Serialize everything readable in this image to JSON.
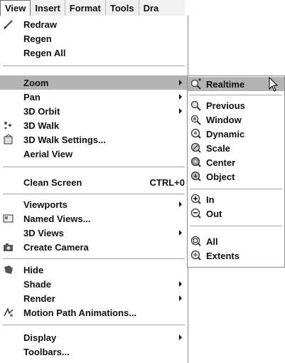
{
  "menubar": [
    {
      "label": "View",
      "active": true
    },
    {
      "label": "Insert"
    },
    {
      "label": "Format"
    },
    {
      "label": "Tools"
    },
    {
      "label": "Dra",
      "clipped": true
    }
  ],
  "view_menu": {
    "items": [
      {
        "label": "Redraw",
        "icon": "pencil-icon"
      },
      {
        "label": "Regen"
      },
      {
        "label": "Regen All"
      },
      {
        "label": "Zoom",
        "submenu": true,
        "highlighted": true
      },
      {
        "label": "Pan",
        "submenu": true
      },
      {
        "label": "3D Orbit",
        "submenu": true
      },
      {
        "label": "3D Walk",
        "icon": "walk-icon"
      },
      {
        "label": "3D Walk Settings...",
        "icon": "walk-settings-icon"
      },
      {
        "label": "Aerial View"
      },
      {
        "label": "Clean Screen",
        "shortcut": "CTRL+0"
      },
      {
        "label": "Viewports",
        "submenu": true
      },
      {
        "label": "Named Views...",
        "icon": "named-views-icon"
      },
      {
        "label": "3D Views",
        "submenu": true
      },
      {
        "label": "Create Camera",
        "icon": "camera-icon"
      },
      {
        "label": "Hide",
        "icon": "hide-icon"
      },
      {
        "label": "Shade",
        "submenu": true
      },
      {
        "label": "Render",
        "submenu": true
      },
      {
        "label": "Motion Path Animations...",
        "icon": "motion-path-icon"
      },
      {
        "label": "Display",
        "submenu": true
      },
      {
        "label": "Toolbars..."
      }
    ]
  },
  "zoom_submenu": {
    "items": [
      {
        "label": "Realtime",
        "icon": "zoom-realtime-icon",
        "highlighted": true
      },
      {
        "label": "Previous",
        "icon": "zoom-previous-icon"
      },
      {
        "label": "Window",
        "icon": "zoom-window-icon"
      },
      {
        "label": "Dynamic",
        "icon": "zoom-dynamic-icon"
      },
      {
        "label": "Scale",
        "icon": "zoom-scale-icon"
      },
      {
        "label": "Center",
        "icon": "zoom-center-icon"
      },
      {
        "label": "Object",
        "icon": "zoom-object-icon"
      },
      {
        "label": "In",
        "icon": "zoom-in-icon"
      },
      {
        "label": "Out",
        "icon": "zoom-out-icon"
      },
      {
        "label": "All",
        "icon": "zoom-all-icon"
      },
      {
        "label": "Extents",
        "icon": "zoom-extents-icon"
      }
    ]
  }
}
